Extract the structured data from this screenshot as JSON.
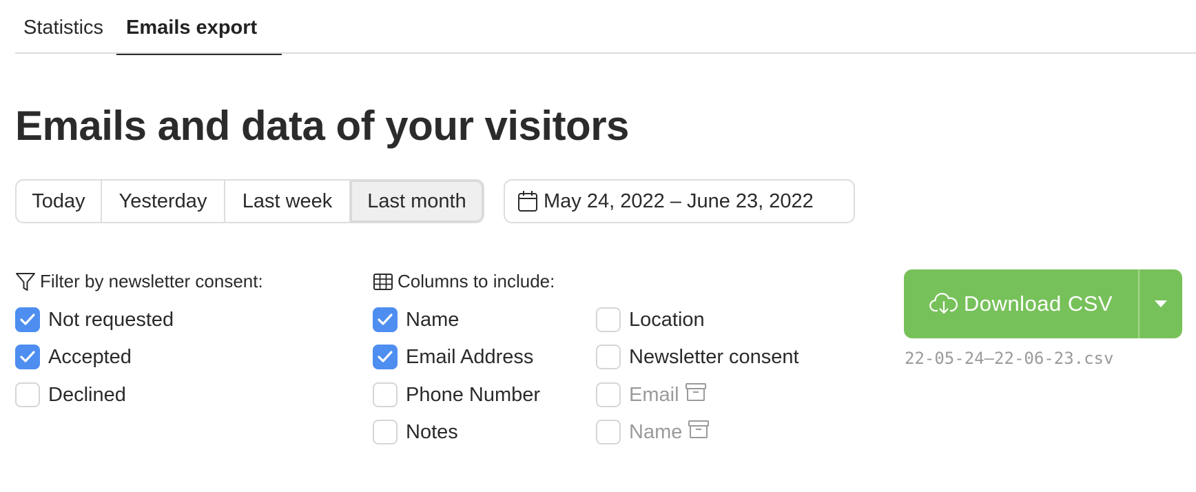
{
  "tabs": {
    "statistics": "Statistics",
    "emails_export": "Emails export"
  },
  "page_title": "Emails and data of your visitors",
  "periods": {
    "today": "Today",
    "yesterday": "Yesterday",
    "last_week": "Last week",
    "last_month": "Last month",
    "selected": "Last month"
  },
  "date_range": {
    "label": "May 24, 2022 – June 23, 2022",
    "icon": "calendar-icon"
  },
  "filter": {
    "label": "Filter by newsletter consent:",
    "icon": "filter-icon",
    "options": [
      {
        "label": "Not requested",
        "checked": true
      },
      {
        "label": "Accepted",
        "checked": true
      },
      {
        "label": "Declined",
        "checked": false
      }
    ]
  },
  "columns": {
    "label": "Columns to include:",
    "icon": "table-icon",
    "options": [
      {
        "label": "Name",
        "checked": true
      },
      {
        "label": "Email Address",
        "checked": true
      },
      {
        "label": "Phone Number",
        "checked": false
      },
      {
        "label": "Notes",
        "checked": false
      },
      {
        "label": "Location",
        "checked": false
      },
      {
        "label": "Newsletter consent",
        "checked": false
      },
      {
        "label": "Email",
        "checked": false,
        "archived": true
      },
      {
        "label": "Name",
        "checked": false,
        "archived": true
      }
    ]
  },
  "download": {
    "label": "Download CSV",
    "icon": "cloud-download-icon",
    "filename": "22-05-24—22-06-23.csv",
    "color": "#77c15a"
  },
  "colors": {
    "checkbox_checked": "#4e8ef0",
    "selected_period_bg": "#efefef"
  }
}
